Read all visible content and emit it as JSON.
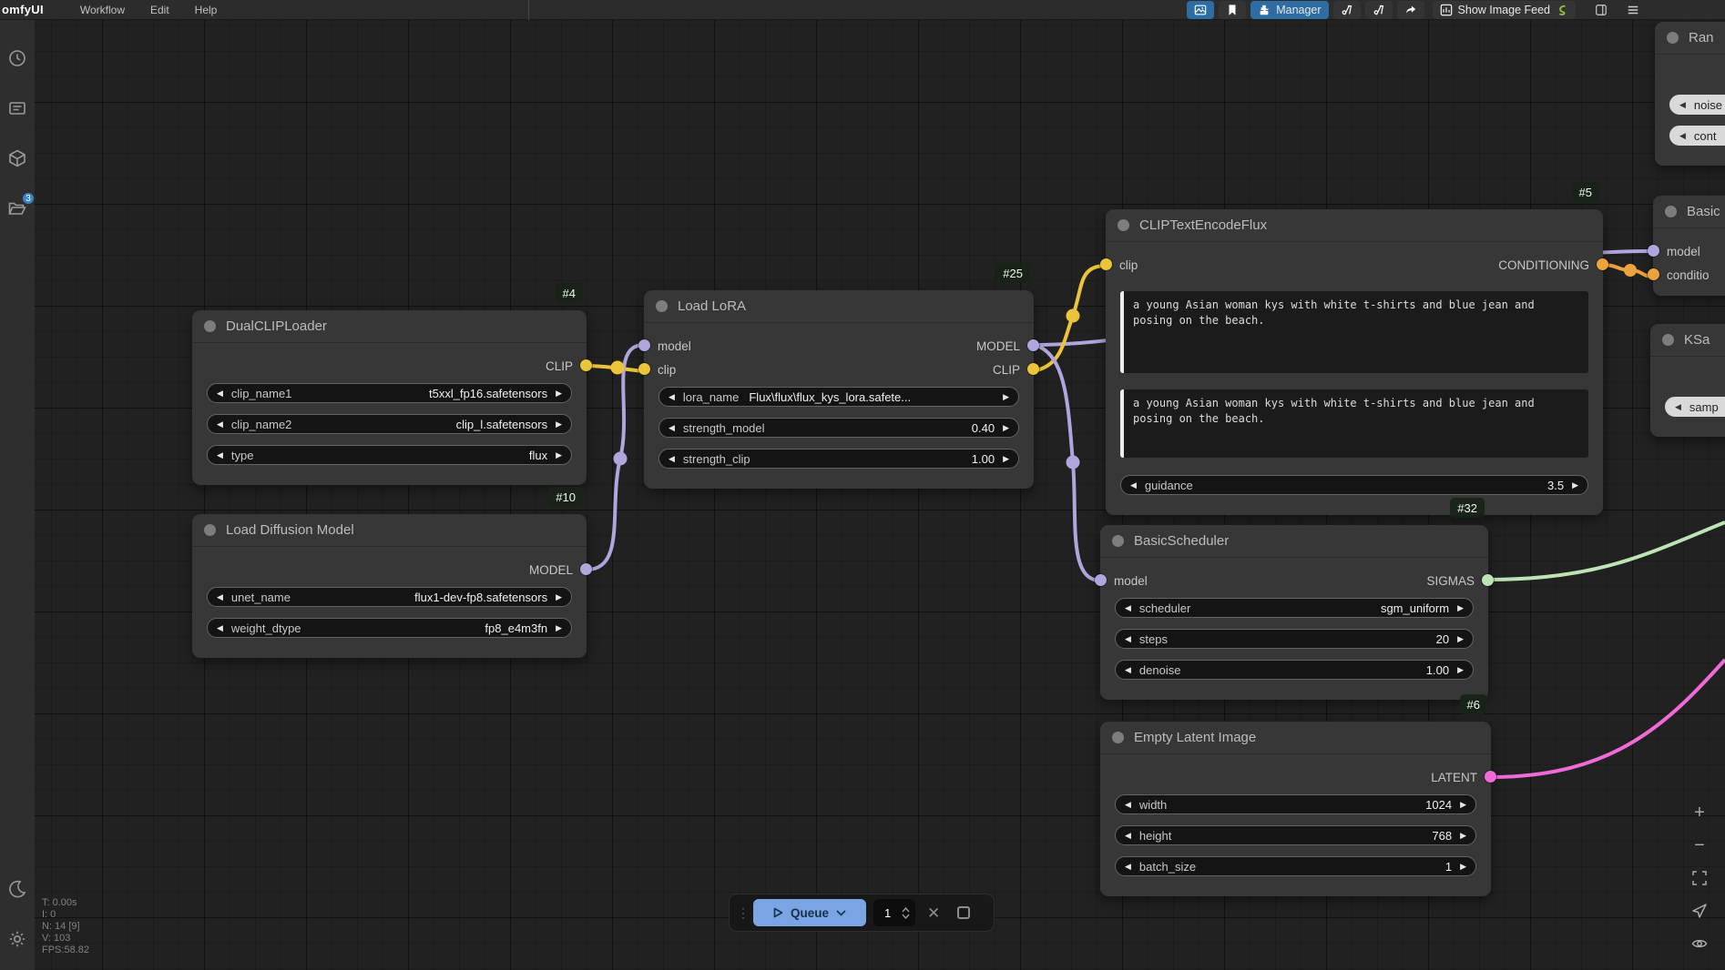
{
  "menubar": {
    "logo": "omfyUI",
    "menu_items": [
      "Workflow",
      "Edit",
      "Help"
    ],
    "manager_label": "Manager",
    "show_image_feed_label": "Show Image Feed"
  },
  "sidebar": {
    "workflows_badge": "3"
  },
  "canvas_stats": {
    "line1": "T: 0.00s",
    "line2": "I: 0",
    "line3": "N: 14 [9]",
    "line4": "V: 103",
    "line5": "FPS:58.82"
  },
  "queue_controls": {
    "queue_label": "Queue",
    "batch_count": "1"
  },
  "colors": {
    "model_port": "#b2a4dc",
    "clip_port": "#ecc439",
    "conditioning_port": "#eda23d",
    "sigmas_port": "#bde4b4",
    "latent_port": "#f06ad8",
    "accent_blue": "#2d6da3",
    "queue_button_blue": "#7ba5e2",
    "badge_blue": "#3b82c6"
  },
  "nodes": {
    "dualclip": {
      "badge": "#4",
      "title": "DualCLIPLoader",
      "outputs": [
        "CLIP"
      ],
      "widgets": [
        {
          "label": "clip_name1",
          "value": "t5xxl_fp16.safetensors"
        },
        {
          "label": "clip_name2",
          "value": "clip_l.safetensors"
        },
        {
          "label": "type",
          "value": "flux"
        }
      ]
    },
    "load_diffusion": {
      "badge": "#10",
      "title": "Load Diffusion Model",
      "outputs": [
        "MODEL"
      ],
      "widgets": [
        {
          "label": "unet_name",
          "value": "flux1-dev-fp8.safetensors"
        },
        {
          "label": "weight_dtype",
          "value": "fp8_e4m3fn"
        }
      ]
    },
    "load_lora": {
      "badge": "#25",
      "title": "Load LoRA",
      "inputs": [
        "model",
        "clip"
      ],
      "outputs": [
        "MODEL",
        "CLIP"
      ],
      "widgets": [
        {
          "label": "lora_name",
          "value": "Flux\\flux\\flux_kys_lora.safete..."
        },
        {
          "label": "strength_model",
          "value": "0.40"
        },
        {
          "label": "strength_clip",
          "value": "1.00"
        }
      ]
    },
    "clip_text_encode": {
      "badge": "#5",
      "title": "CLIPTextEncodeFlux",
      "inputs": [
        "clip"
      ],
      "outputs": [
        "CONDITIONING"
      ],
      "prompt1": "a young Asian woman kys with white t-shirts and blue jean and posing on the beach.",
      "prompt2": "a young Asian woman kys with white t-shirts and blue jean and posing on the beach.",
      "widgets": [
        {
          "label": "guidance",
          "value": "3.5"
        }
      ]
    },
    "basic_scheduler": {
      "badge": "#32",
      "title": "BasicScheduler",
      "inputs": [
        "model"
      ],
      "outputs": [
        "SIGMAS"
      ],
      "widgets": [
        {
          "label": "scheduler",
          "value": "sgm_uniform"
        },
        {
          "label": "steps",
          "value": "20"
        },
        {
          "label": "denoise",
          "value": "1.00"
        }
      ]
    },
    "empty_latent": {
      "badge": "#6",
      "title": "Empty Latent Image",
      "outputs": [
        "LATENT"
      ],
      "widgets": [
        {
          "label": "width",
          "value": "1024"
        },
        {
          "label": "height",
          "value": "768"
        },
        {
          "label": "batch_size",
          "value": "1"
        }
      ]
    },
    "random_noise_partial": {
      "title": "Ran",
      "widgets": [
        {
          "label": "noise"
        },
        {
          "label": "cont"
        }
      ]
    },
    "basic_guider_partial": {
      "title": "Basic",
      "inputs": [
        "model",
        "conditio"
      ]
    },
    "ksampler_partial": {
      "title": "KSa",
      "widgets": [
        {
          "label": "samp"
        }
      ]
    }
  }
}
